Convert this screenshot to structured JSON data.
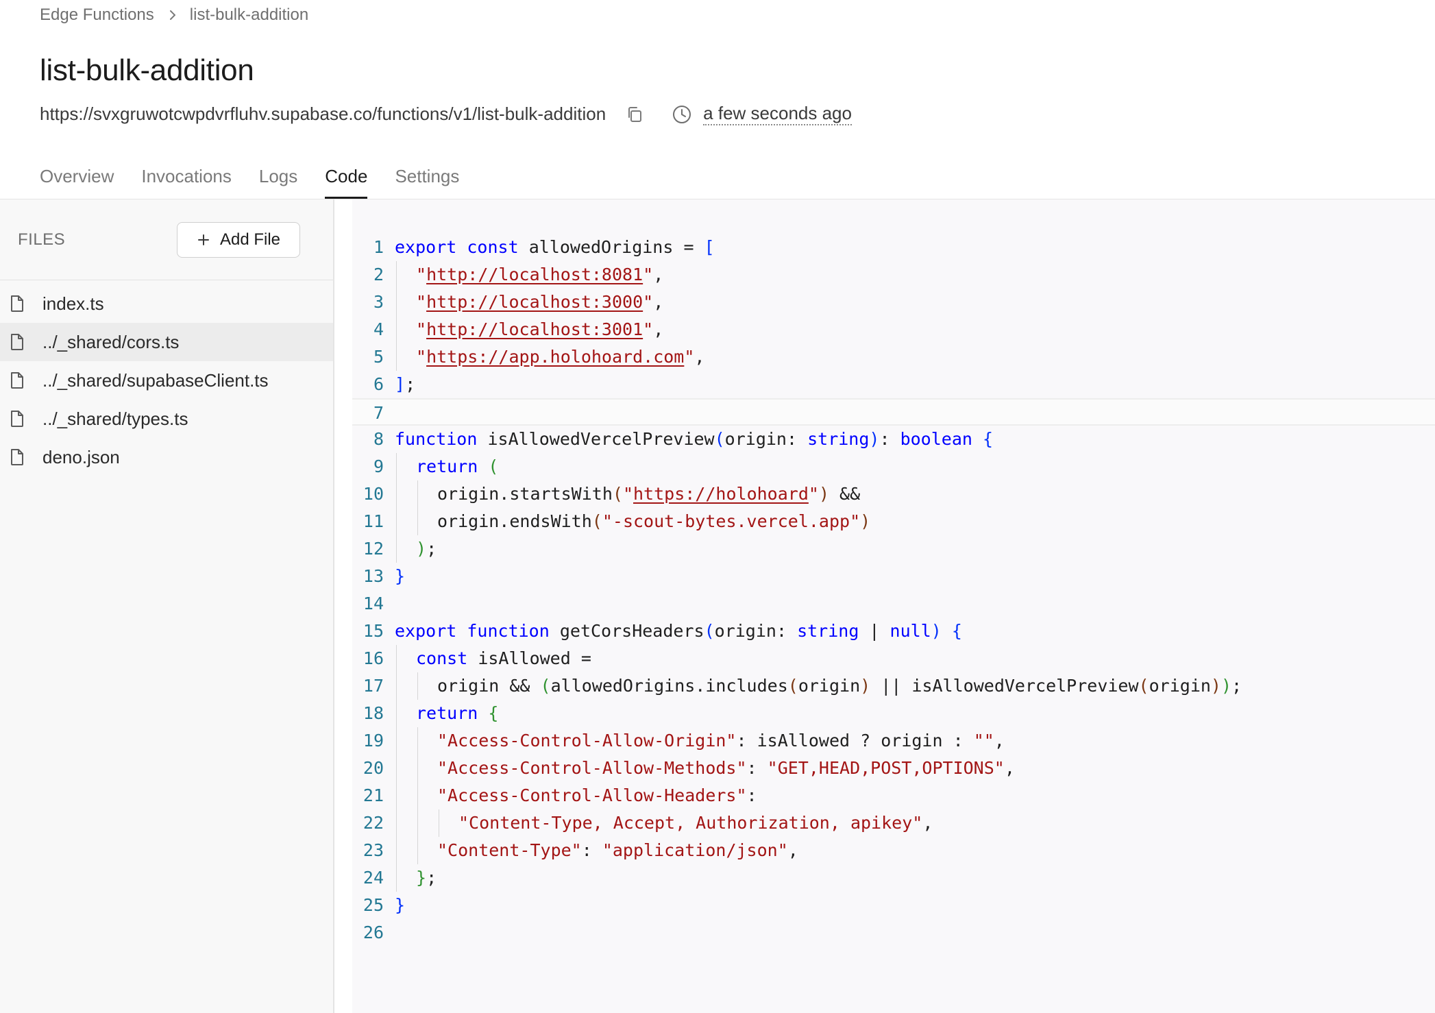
{
  "breadcrumb": {
    "parent": "Edge Functions",
    "current": "list-bulk-addition"
  },
  "page": {
    "title": "list-bulk-addition",
    "url": "https://svxgruwotcwpdvrfluhv.supabase.co/functions/v1/list-bulk-addition",
    "updated": "a few seconds ago"
  },
  "tabs": [
    {
      "label": "Overview"
    },
    {
      "label": "Invocations"
    },
    {
      "label": "Logs"
    },
    {
      "label": "Code",
      "active": true
    },
    {
      "label": "Settings"
    }
  ],
  "sidebar": {
    "files_label": "FILES",
    "add_file_label": "Add File",
    "files": [
      {
        "name": "index.ts"
      },
      {
        "name": "../_shared/cors.ts",
        "selected": true
      },
      {
        "name": "../_shared/supabaseClient.ts"
      },
      {
        "name": "../_shared/types.ts"
      },
      {
        "name": "deno.json"
      }
    ]
  },
  "editor": {
    "current_line": 7,
    "lines": [
      {
        "n": "1",
        "indent": 0,
        "tokens": [
          [
            "kw",
            "export"
          ],
          [
            "id",
            " "
          ],
          [
            "kw",
            "const"
          ],
          [
            "id",
            " allowedOrigins = "
          ],
          [
            "br1",
            "["
          ]
        ]
      },
      {
        "n": "2",
        "indent": 1,
        "tokens": [
          [
            "str",
            "\""
          ],
          [
            "url",
            "http://localhost:8081"
          ],
          [
            "str",
            "\""
          ],
          [
            "id",
            ","
          ]
        ]
      },
      {
        "n": "3",
        "indent": 1,
        "tokens": [
          [
            "str",
            "\""
          ],
          [
            "url",
            "http://localhost:3000"
          ],
          [
            "str",
            "\""
          ],
          [
            "id",
            ","
          ]
        ]
      },
      {
        "n": "4",
        "indent": 1,
        "tokens": [
          [
            "str",
            "\""
          ],
          [
            "url",
            "http://localhost:3001"
          ],
          [
            "str",
            "\""
          ],
          [
            "id",
            ","
          ]
        ]
      },
      {
        "n": "5",
        "indent": 1,
        "tokens": [
          [
            "str",
            "\""
          ],
          [
            "url",
            "https://app.holohoard.com"
          ],
          [
            "str",
            "\""
          ],
          [
            "id",
            ","
          ]
        ]
      },
      {
        "n": "6",
        "indent": 0,
        "tokens": [
          [
            "br1",
            "]"
          ],
          [
            "id",
            ";"
          ]
        ]
      },
      {
        "n": "7",
        "indent": 0,
        "tokens": []
      },
      {
        "n": "8",
        "indent": 0,
        "tokens": [
          [
            "kw",
            "function"
          ],
          [
            "id",
            " isAllowedVercelPreview"
          ],
          [
            "br1",
            "("
          ],
          [
            "id",
            "origin: "
          ],
          [
            "ty",
            "string"
          ],
          [
            "br1",
            ")"
          ],
          [
            "id",
            ": "
          ],
          [
            "ty",
            "boolean"
          ],
          [
            "id",
            " "
          ],
          [
            "br1",
            "{"
          ]
        ]
      },
      {
        "n": "9",
        "indent": 1,
        "tokens": [
          [
            "kw",
            "return"
          ],
          [
            "id",
            " "
          ],
          [
            "br2",
            "("
          ]
        ]
      },
      {
        "n": "10",
        "indent": 2,
        "tokens": [
          [
            "id",
            "origin.startsWith"
          ],
          [
            "br3",
            "("
          ],
          [
            "str",
            "\""
          ],
          [
            "url",
            "https://holohoard"
          ],
          [
            "str",
            "\""
          ],
          [
            "br3",
            ")"
          ],
          [
            "id",
            " &&"
          ]
        ]
      },
      {
        "n": "11",
        "indent": 2,
        "tokens": [
          [
            "id",
            "origin.endsWith"
          ],
          [
            "br3",
            "("
          ],
          [
            "str",
            "\"-scout-bytes.vercel.app\""
          ],
          [
            "br3",
            ")"
          ]
        ]
      },
      {
        "n": "12",
        "indent": 1,
        "tokens": [
          [
            "br2",
            ")"
          ],
          [
            "id",
            ";"
          ]
        ]
      },
      {
        "n": "13",
        "indent": 0,
        "tokens": [
          [
            "br1",
            "}"
          ]
        ]
      },
      {
        "n": "14",
        "indent": 0,
        "tokens": []
      },
      {
        "n": "15",
        "indent": 0,
        "tokens": [
          [
            "kw",
            "export"
          ],
          [
            "id",
            " "
          ],
          [
            "kw",
            "function"
          ],
          [
            "id",
            " getCorsHeaders"
          ],
          [
            "br1",
            "("
          ],
          [
            "id",
            "origin: "
          ],
          [
            "ty",
            "string"
          ],
          [
            "id",
            " | "
          ],
          [
            "ty",
            "null"
          ],
          [
            "br1",
            ")"
          ],
          [
            "id",
            " "
          ],
          [
            "br1",
            "{"
          ]
        ]
      },
      {
        "n": "16",
        "indent": 1,
        "tokens": [
          [
            "kw",
            "const"
          ],
          [
            "id",
            " isAllowed ="
          ]
        ]
      },
      {
        "n": "17",
        "indent": 2,
        "tokens": [
          [
            "id",
            "origin && "
          ],
          [
            "br2",
            "("
          ],
          [
            "id",
            "allowedOrigins.includes"
          ],
          [
            "br3",
            "("
          ],
          [
            "id",
            "origin"
          ],
          [
            "br3",
            ")"
          ],
          [
            "id",
            " || isAllowedVercelPreview"
          ],
          [
            "br3",
            "("
          ],
          [
            "id",
            "origin"
          ],
          [
            "br3",
            ")"
          ],
          [
            "br2",
            ")"
          ],
          [
            "id",
            ";"
          ]
        ]
      },
      {
        "n": "18",
        "indent": 1,
        "tokens": [
          [
            "kw",
            "return"
          ],
          [
            "id",
            " "
          ],
          [
            "br2",
            "{"
          ]
        ]
      },
      {
        "n": "19",
        "indent": 2,
        "tokens": [
          [
            "str",
            "\"Access-Control-Allow-Origin\""
          ],
          [
            "id",
            ": isAllowed ? origin : "
          ],
          [
            "str",
            "\"\""
          ],
          [
            "id",
            ","
          ]
        ]
      },
      {
        "n": "20",
        "indent": 2,
        "tokens": [
          [
            "str",
            "\"Access-Control-Allow-Methods\""
          ],
          [
            "id",
            ": "
          ],
          [
            "str",
            "\"GET,HEAD,POST,OPTIONS\""
          ],
          [
            "id",
            ","
          ]
        ]
      },
      {
        "n": "21",
        "indent": 2,
        "tokens": [
          [
            "str",
            "\"Access-Control-Allow-Headers\""
          ],
          [
            "id",
            ":"
          ]
        ]
      },
      {
        "n": "22",
        "indent": 3,
        "tokens": [
          [
            "str",
            "\"Content-Type, Accept, Authorization, apikey\""
          ],
          [
            "id",
            ","
          ]
        ]
      },
      {
        "n": "23",
        "indent": 2,
        "tokens": [
          [
            "str",
            "\"Content-Type\""
          ],
          [
            "id",
            ": "
          ],
          [
            "str",
            "\"application/json\""
          ],
          [
            "id",
            ","
          ]
        ]
      },
      {
        "n": "24",
        "indent": 1,
        "tokens": [
          [
            "br2",
            "}"
          ],
          [
            "id",
            ";"
          ]
        ]
      },
      {
        "n": "25",
        "indent": 0,
        "tokens": [
          [
            "br1",
            "}"
          ]
        ]
      },
      {
        "n": "26",
        "indent": 0,
        "tokens": []
      }
    ]
  }
}
